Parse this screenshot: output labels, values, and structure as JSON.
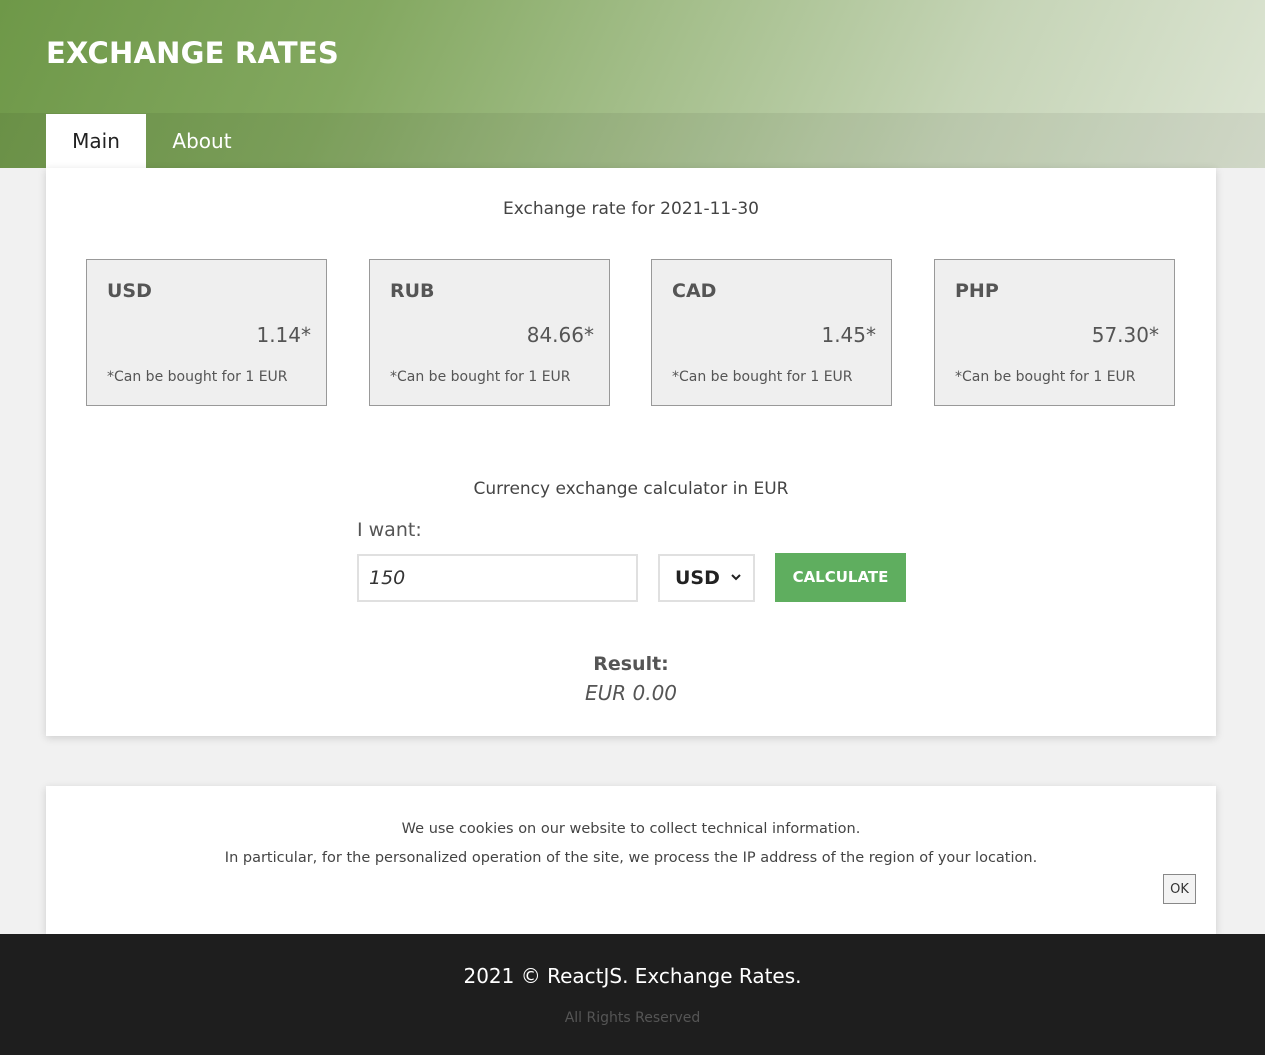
{
  "header": {
    "title": "EXCHANGE RATES"
  },
  "tabs": [
    {
      "label": "Main",
      "active": true
    },
    {
      "label": "About",
      "active": false
    }
  ],
  "rates": {
    "date_text": "Exchange rate for 2021-11-30",
    "cards": [
      {
        "code": "USD",
        "value": "1.14*",
        "note": "*Can be bought for 1 EUR"
      },
      {
        "code": "RUB",
        "value": "84.66*",
        "note": "*Can be bought for 1 EUR"
      },
      {
        "code": "CAD",
        "value": "1.45*",
        "note": "*Can be bought for 1 EUR"
      },
      {
        "code": "PHP",
        "value": "57.30*",
        "note": "*Can be bought for 1 EUR"
      }
    ]
  },
  "calculator": {
    "title": "Currency exchange calculator in EUR",
    "want_label": "I want:",
    "amount_value": "150",
    "currency_selected": "USD",
    "calculate_label": "CALCULATE",
    "result_label": "Result:",
    "result_value": "EUR 0.00"
  },
  "cookie": {
    "line1": "We use cookies on our website to collect technical information.",
    "line2": "In particular, for the personalized operation of the site, we process the IP address of the region of your location.",
    "ok_label": "OK"
  },
  "footer": {
    "title": "2021 © ReactJS. Exchange Rates.",
    "rights": "All Rights Reserved"
  },
  "colors": {
    "header_gradient_start": "#6e9848",
    "header_gradient_end": "#dde5d4",
    "calculate_button": "#5fae5f",
    "footer_bg": "#1e1e1e",
    "card_bg": "#efefef"
  }
}
